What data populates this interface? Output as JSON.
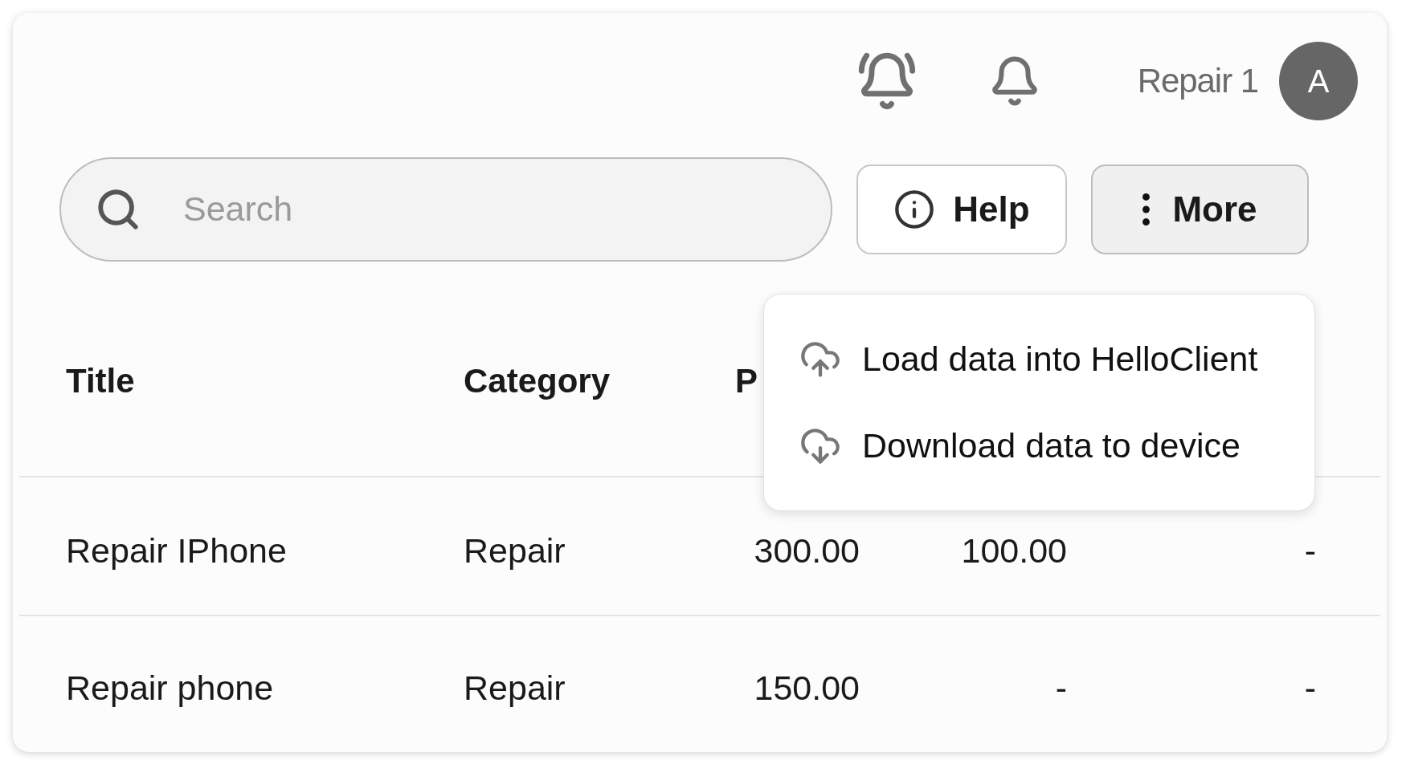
{
  "header": {
    "user_name": "Repair 1",
    "avatar_initial": "A"
  },
  "search": {
    "placeholder": "Search"
  },
  "help_button": {
    "label": "Help"
  },
  "more_button": {
    "label": "More",
    "expanded": true
  },
  "menu": [
    {
      "label": "Load data into HelloClient",
      "kind": "upload"
    },
    {
      "label": "Download data to device",
      "kind": "download"
    }
  ],
  "table": {
    "columns": [
      "Title",
      "Category",
      "P"
    ],
    "rows": [
      [
        "Repair IPhone",
        "Repair",
        "300.00",
        "100.00",
        "-"
      ],
      [
        "Repair phone",
        "Repair",
        "150.00",
        "-",
        "-"
      ]
    ]
  }
}
